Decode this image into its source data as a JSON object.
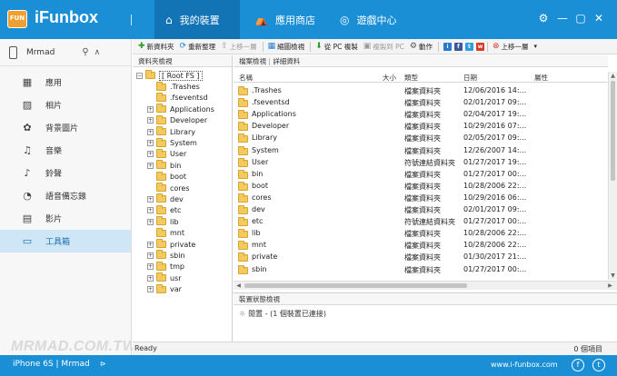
{
  "app": {
    "logo_text": "FUN",
    "title": "iFunbox"
  },
  "tabs": [
    {
      "label": "我的裝置",
      "icon": "home-icon"
    },
    {
      "label": "應用商店",
      "icon": "store-icon"
    },
    {
      "label": "遊戲中心",
      "icon": "gamepad-icon"
    }
  ],
  "window_controls": {
    "settings": "⚙",
    "minimize": "—",
    "maximize": "▢",
    "close": "✕"
  },
  "sidebar": {
    "device_name": "Mrmad",
    "items": [
      {
        "label": "應用",
        "icon": "apps-icon",
        "glyph": "▦"
      },
      {
        "label": "相片",
        "icon": "photo-icon",
        "glyph": "▨"
      },
      {
        "label": "背景圖片",
        "icon": "wallpaper-icon",
        "glyph": "✿"
      },
      {
        "label": "音樂",
        "icon": "music-icon",
        "glyph": "♫"
      },
      {
        "label": "鈴聲",
        "icon": "bell-icon",
        "glyph": "♪"
      },
      {
        "label": "語音備忘錄",
        "icon": "voice-memo-icon",
        "glyph": "◔"
      },
      {
        "label": "影片",
        "icon": "video-icon",
        "glyph": "▤"
      },
      {
        "label": "工具箱",
        "icon": "toolbox-icon",
        "glyph": "▭"
      }
    ],
    "watermark": "MRMAD.COM.TW"
  },
  "toolbar": {
    "new_folder": "新資料夾",
    "refresh": "重新整理",
    "up": "上移一層",
    "thumbnail_view": "縮圖檢視",
    "copy_from_pc": "從 PC 複製",
    "copy_to_pc": "複製到 PC",
    "actions": "動作",
    "up_level": "上移一層"
  },
  "tree": {
    "header": "資料夾檢視",
    "root": "[ Root FS ]",
    "folders": [
      ".Trashes",
      ".fseventsd",
      "Applications",
      "Developer",
      "Library",
      "System",
      "User",
      "bin",
      "boot",
      "cores",
      "dev",
      "etc",
      "lib",
      "mnt",
      "private",
      "sbin",
      "tmp",
      "usr",
      "var"
    ]
  },
  "list": {
    "header_left": "檔案檢視",
    "header_right": "詳細資料",
    "columns": {
      "name": "名稱",
      "size": "大小",
      "type": "類型",
      "date": "日期",
      "attr": "屬性"
    },
    "rows": [
      {
        "name": ".Trashes",
        "type": "檔案資料夾",
        "date": "12/06/2016 14:..."
      },
      {
        "name": ".fseventsd",
        "type": "檔案資料夾",
        "date": "02/01/2017 09:..."
      },
      {
        "name": "Applications",
        "type": "檔案資料夾",
        "date": "02/04/2017 19:..."
      },
      {
        "name": "Developer",
        "type": "檔案資料夾",
        "date": "10/29/2016 07:..."
      },
      {
        "name": "Library",
        "type": "檔案資料夾",
        "date": "02/05/2017 09:..."
      },
      {
        "name": "System",
        "type": "檔案資料夾",
        "date": "12/26/2007 14:..."
      },
      {
        "name": "User",
        "type": "符號連結資料夾",
        "date": "01/27/2017 19:..."
      },
      {
        "name": "bin",
        "type": "檔案資料夾",
        "date": "01/27/2017 00:..."
      },
      {
        "name": "boot",
        "type": "檔案資料夾",
        "date": "10/28/2006 22:..."
      },
      {
        "name": "cores",
        "type": "檔案資料夾",
        "date": "10/29/2016 06:..."
      },
      {
        "name": "dev",
        "type": "檔案資料夾",
        "date": "02/01/2017 09:..."
      },
      {
        "name": "etc",
        "type": "符號連結資料夾",
        "date": "01/27/2017 00:..."
      },
      {
        "name": "lib",
        "type": "檔案資料夾",
        "date": "10/28/2006 22:..."
      },
      {
        "name": "mnt",
        "type": "檔案資料夾",
        "date": "10/28/2006 22:..."
      },
      {
        "name": "private",
        "type": "檔案資料夾",
        "date": "01/30/2017 21:..."
      },
      {
        "name": "sbin",
        "type": "檔案資料夾",
        "date": "01/27/2017 00:..."
      }
    ]
  },
  "status_panel": {
    "header": "裝置狀態檢視",
    "line": "閒置 - (1 個裝置已連接)"
  },
  "readybar": {
    "left": "Ready",
    "right": "0 個項目"
  },
  "bottombar": {
    "device": "iPhone 6S | Mrmad",
    "url": "www.i-funbox.com"
  }
}
